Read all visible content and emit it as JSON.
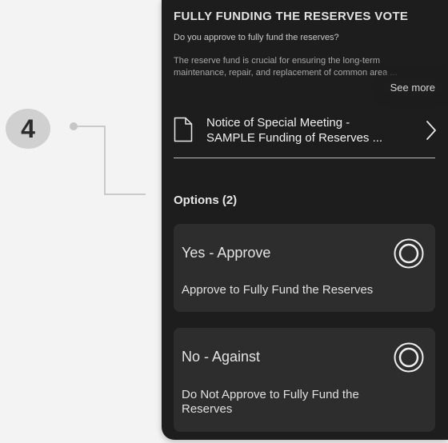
{
  "step": {
    "number": "4"
  },
  "vote": {
    "title": "FULLY FUNDING THE RESERVES VOTE",
    "question": "Do you approve to fully fund the reserves?",
    "description": "The reserve fund is crucial for ensuring the long-term maintenance, repair, and replacement of common area ...",
    "see_more": "See more"
  },
  "document": {
    "icon": "document-icon",
    "title_line1": "Notice of Special Meeting -",
    "title_line2": "SAMPLE Funding of Reserves ...",
    "chevron": "chevron-right-icon"
  },
  "options": {
    "heading": "Options (2)",
    "items": [
      {
        "label": "Yes - Approve",
        "description": "Approve to Fully Fund the Reserves"
      },
      {
        "label": "No - Against",
        "description": "Do Not Approve to Fully Fund the Reserves"
      }
    ]
  },
  "colors": {
    "page_background": "#f3f3f3",
    "panel_background": "#1d1d1d",
    "card_background": "#2d2d2d",
    "badge_background": "#d0d0d0",
    "connector": "#bdbdbd"
  }
}
